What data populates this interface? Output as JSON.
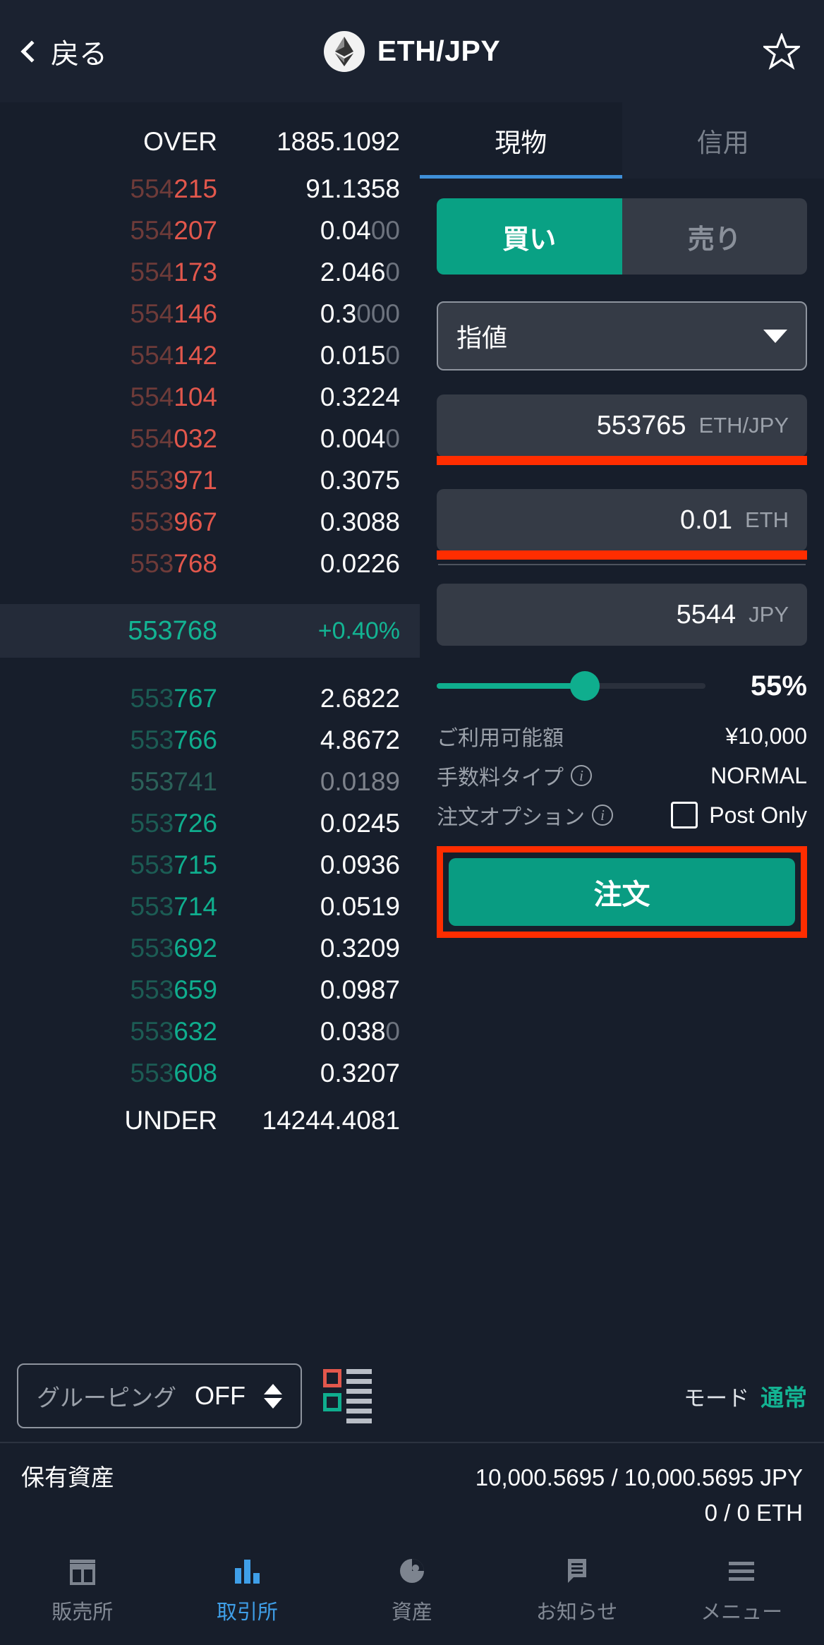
{
  "header": {
    "back_label": "戻る",
    "pair_title": "ETH/JPY",
    "back_icon": "chevron-left-icon",
    "coin_icon": "ethereum-icon",
    "favorite_icon": "star-outline-icon"
  },
  "orderbook": {
    "over_label": "OVER",
    "over_value": "1885.1092",
    "under_label": "UNDER",
    "under_value": "14244.4081",
    "asks": [
      {
        "price_dim": "554",
        "price": "215",
        "qty": "91.1358",
        "qty_dim": ""
      },
      {
        "price_dim": "554",
        "price": "207",
        "qty": "0.04",
        "qty_dim": "00"
      },
      {
        "price_dim": "554",
        "price": "173",
        "qty": "2.046",
        "qty_dim": "0"
      },
      {
        "price_dim": "554",
        "price": "146",
        "qty": "0.3",
        "qty_dim": "000"
      },
      {
        "price_dim": "554",
        "price": "142",
        "qty": "0.015",
        "qty_dim": "0"
      },
      {
        "price_dim": "554",
        "price": "104",
        "qty": "0.3224",
        "qty_dim": ""
      },
      {
        "price_dim": "554",
        "price": "032",
        "qty": "0.004",
        "qty_dim": "0"
      },
      {
        "price_dim": "553",
        "price": "971",
        "qty": "0.3075",
        "qty_dim": ""
      },
      {
        "price_dim": "553",
        "price": "967",
        "qty": "0.3088",
        "qty_dim": ""
      },
      {
        "price_dim": "553",
        "price": "768",
        "qty": "0.0226",
        "qty_dim": ""
      }
    ],
    "current": {
      "price": "553768",
      "change": "+0.40%"
    },
    "bids": [
      {
        "price_dim": "553",
        "price": "767",
        "qty": "2.6822",
        "qty_dim": "",
        "faded": false
      },
      {
        "price_dim": "553",
        "price": "766",
        "qty": "4.8672",
        "qty_dim": "",
        "faded": false
      },
      {
        "price_dim": "553",
        "price": "741",
        "qty": "0.0189",
        "qty_dim": "",
        "faded": true
      },
      {
        "price_dim": "553",
        "price": "726",
        "qty": "0.0245",
        "qty_dim": "",
        "faded": false
      },
      {
        "price_dim": "553",
        "price": "715",
        "qty": "0.0936",
        "qty_dim": "",
        "faded": false
      },
      {
        "price_dim": "553",
        "price": "714",
        "qty": "0.0519",
        "qty_dim": "",
        "faded": false
      },
      {
        "price_dim": "553",
        "price": "692",
        "qty": "0.3209",
        "qty_dim": "",
        "faded": false
      },
      {
        "price_dim": "553",
        "price": "659",
        "qty": "0.0987",
        "qty_dim": "",
        "faded": false
      },
      {
        "price_dim": "553",
        "price": "632",
        "qty": "0.038",
        "qty_dim": "0",
        "faded": false
      },
      {
        "price_dim": "553",
        "price": "608",
        "qty": "0.3207",
        "qty_dim": "",
        "faded": false
      }
    ],
    "controls": {
      "grouping_label": "グルーピング",
      "grouping_value": "OFF",
      "layout_icon": "book-layout-icon",
      "mode_label": "モード",
      "mode_value": "通常"
    }
  },
  "form": {
    "tabs": [
      {
        "label": "現物",
        "active": true
      },
      {
        "label": "信用",
        "active": false
      }
    ],
    "sides": [
      {
        "label": "買い",
        "active": true
      },
      {
        "label": "売り",
        "active": false
      }
    ],
    "order_type": "指値",
    "price_field": {
      "value": "553765",
      "unit": "ETH/JPY"
    },
    "amount_field": {
      "value": "0.01",
      "unit": "ETH"
    },
    "total_field": {
      "value": "5544",
      "unit": "JPY"
    },
    "slider_percent": "55%",
    "slider_fill": 55,
    "available_label": "ご利用可能額",
    "available_value": "¥10,000",
    "fee_type_label": "手数料タイプ",
    "fee_type_value": "NORMAL",
    "order_option_label": "注文オプション",
    "post_only_label": "Post Only",
    "submit_label": "注文"
  },
  "holdings": {
    "label": "保有資産",
    "jpy": "10,000.5695 / 10,000.5695  JPY",
    "eth": "0 / 0  ETH"
  },
  "nav": [
    {
      "label": "販売所",
      "icon": "store-icon",
      "active": false
    },
    {
      "label": "取引所",
      "icon": "bar-chart-icon",
      "active": true
    },
    {
      "label": "資産",
      "icon": "pie-chart-icon",
      "active": false
    },
    {
      "label": "お知らせ",
      "icon": "message-icon",
      "active": false
    },
    {
      "label": "メニュー",
      "icon": "hamburger-menu-icon",
      "active": false
    }
  ],
  "colors": {
    "ask": "#e2574c",
    "bid": "#0fae8e",
    "accent": "#09a184",
    "highlight": "#ff2d00",
    "tab_underline": "#3f8fd8"
  }
}
